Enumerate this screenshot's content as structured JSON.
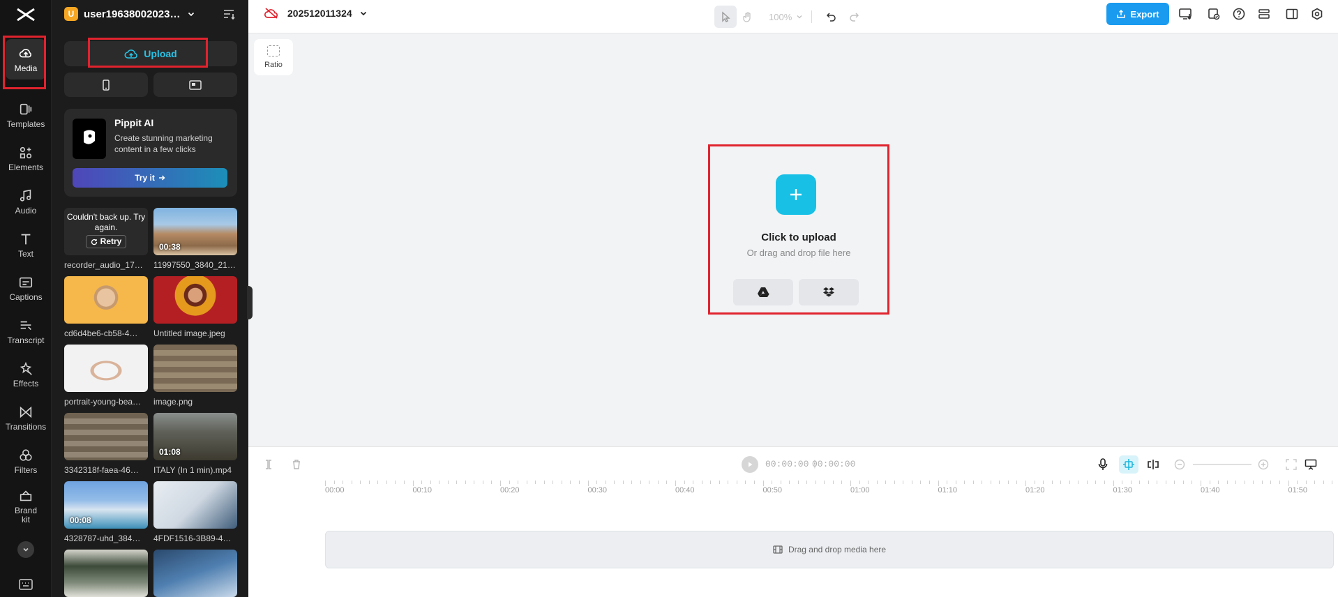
{
  "rail": {
    "items": [
      {
        "label": "Media",
        "icon": "media-icon"
      },
      {
        "label": "Templates",
        "icon": "templates-icon"
      },
      {
        "label": "Elements",
        "icon": "elements-icon"
      },
      {
        "label": "Audio",
        "icon": "audio-icon"
      },
      {
        "label": "Text",
        "icon": "text-icon"
      },
      {
        "label": "Captions",
        "icon": "captions-icon"
      },
      {
        "label": "Transcript",
        "icon": "transcript-icon"
      },
      {
        "label": "Effects",
        "icon": "effects-icon"
      },
      {
        "label": "Transitions",
        "icon": "transitions-icon"
      },
      {
        "label": "Filters",
        "icon": "filters-icon"
      },
      {
        "label": "Brand kit",
        "icon": "brand-kit-icon"
      }
    ]
  },
  "panel": {
    "user_initial": "U",
    "username": "user19638002023…",
    "upload_label": "Upload",
    "promo": {
      "title": "Pippit AI",
      "desc": "Create stunning marketing content in a few clicks",
      "cta": "Try it"
    },
    "media": [
      {
        "name": "recorder_audio_17…",
        "failed": true,
        "fail_text": "Couldn't back up. Try again.",
        "retry": "Retry"
      },
      {
        "name": "11997550_3840_21…",
        "duration": "00:38"
      },
      {
        "name": "cd6d4be6-cb58-4…"
      },
      {
        "name": "Untitled image.jpeg"
      },
      {
        "name": "portrait-young-bea…"
      },
      {
        "name": "image.png"
      },
      {
        "name": "3342318f-faea-46…"
      },
      {
        "name": "ITALY (In 1 min).mp4",
        "duration": "01:08"
      },
      {
        "name": "4328787-uhd_384…",
        "duration": "00:08"
      },
      {
        "name": "4FDF1516-3B89-4…"
      }
    ]
  },
  "topbar": {
    "project_name": "202512011324",
    "zoom": "100%",
    "export_label": "Export"
  },
  "canvas": {
    "ratio_label": "Ratio",
    "upload_title": "Click to upload",
    "upload_sub": "Or drag and drop file here"
  },
  "timeline": {
    "current_time": "00:00:00",
    "total_time": "00:00:00",
    "ticks": [
      "00:00",
      "00:10",
      "00:20",
      "00:30",
      "00:40",
      "00:50",
      "01:00",
      "01:10",
      "01:20",
      "01:30",
      "01:40",
      "01:50"
    ],
    "track_hint": "Drag and drop media here"
  },
  "colors": {
    "accent": "#1a9bf0",
    "upload_cyan": "#18c0e6",
    "highlight_red": "#e0232e"
  }
}
